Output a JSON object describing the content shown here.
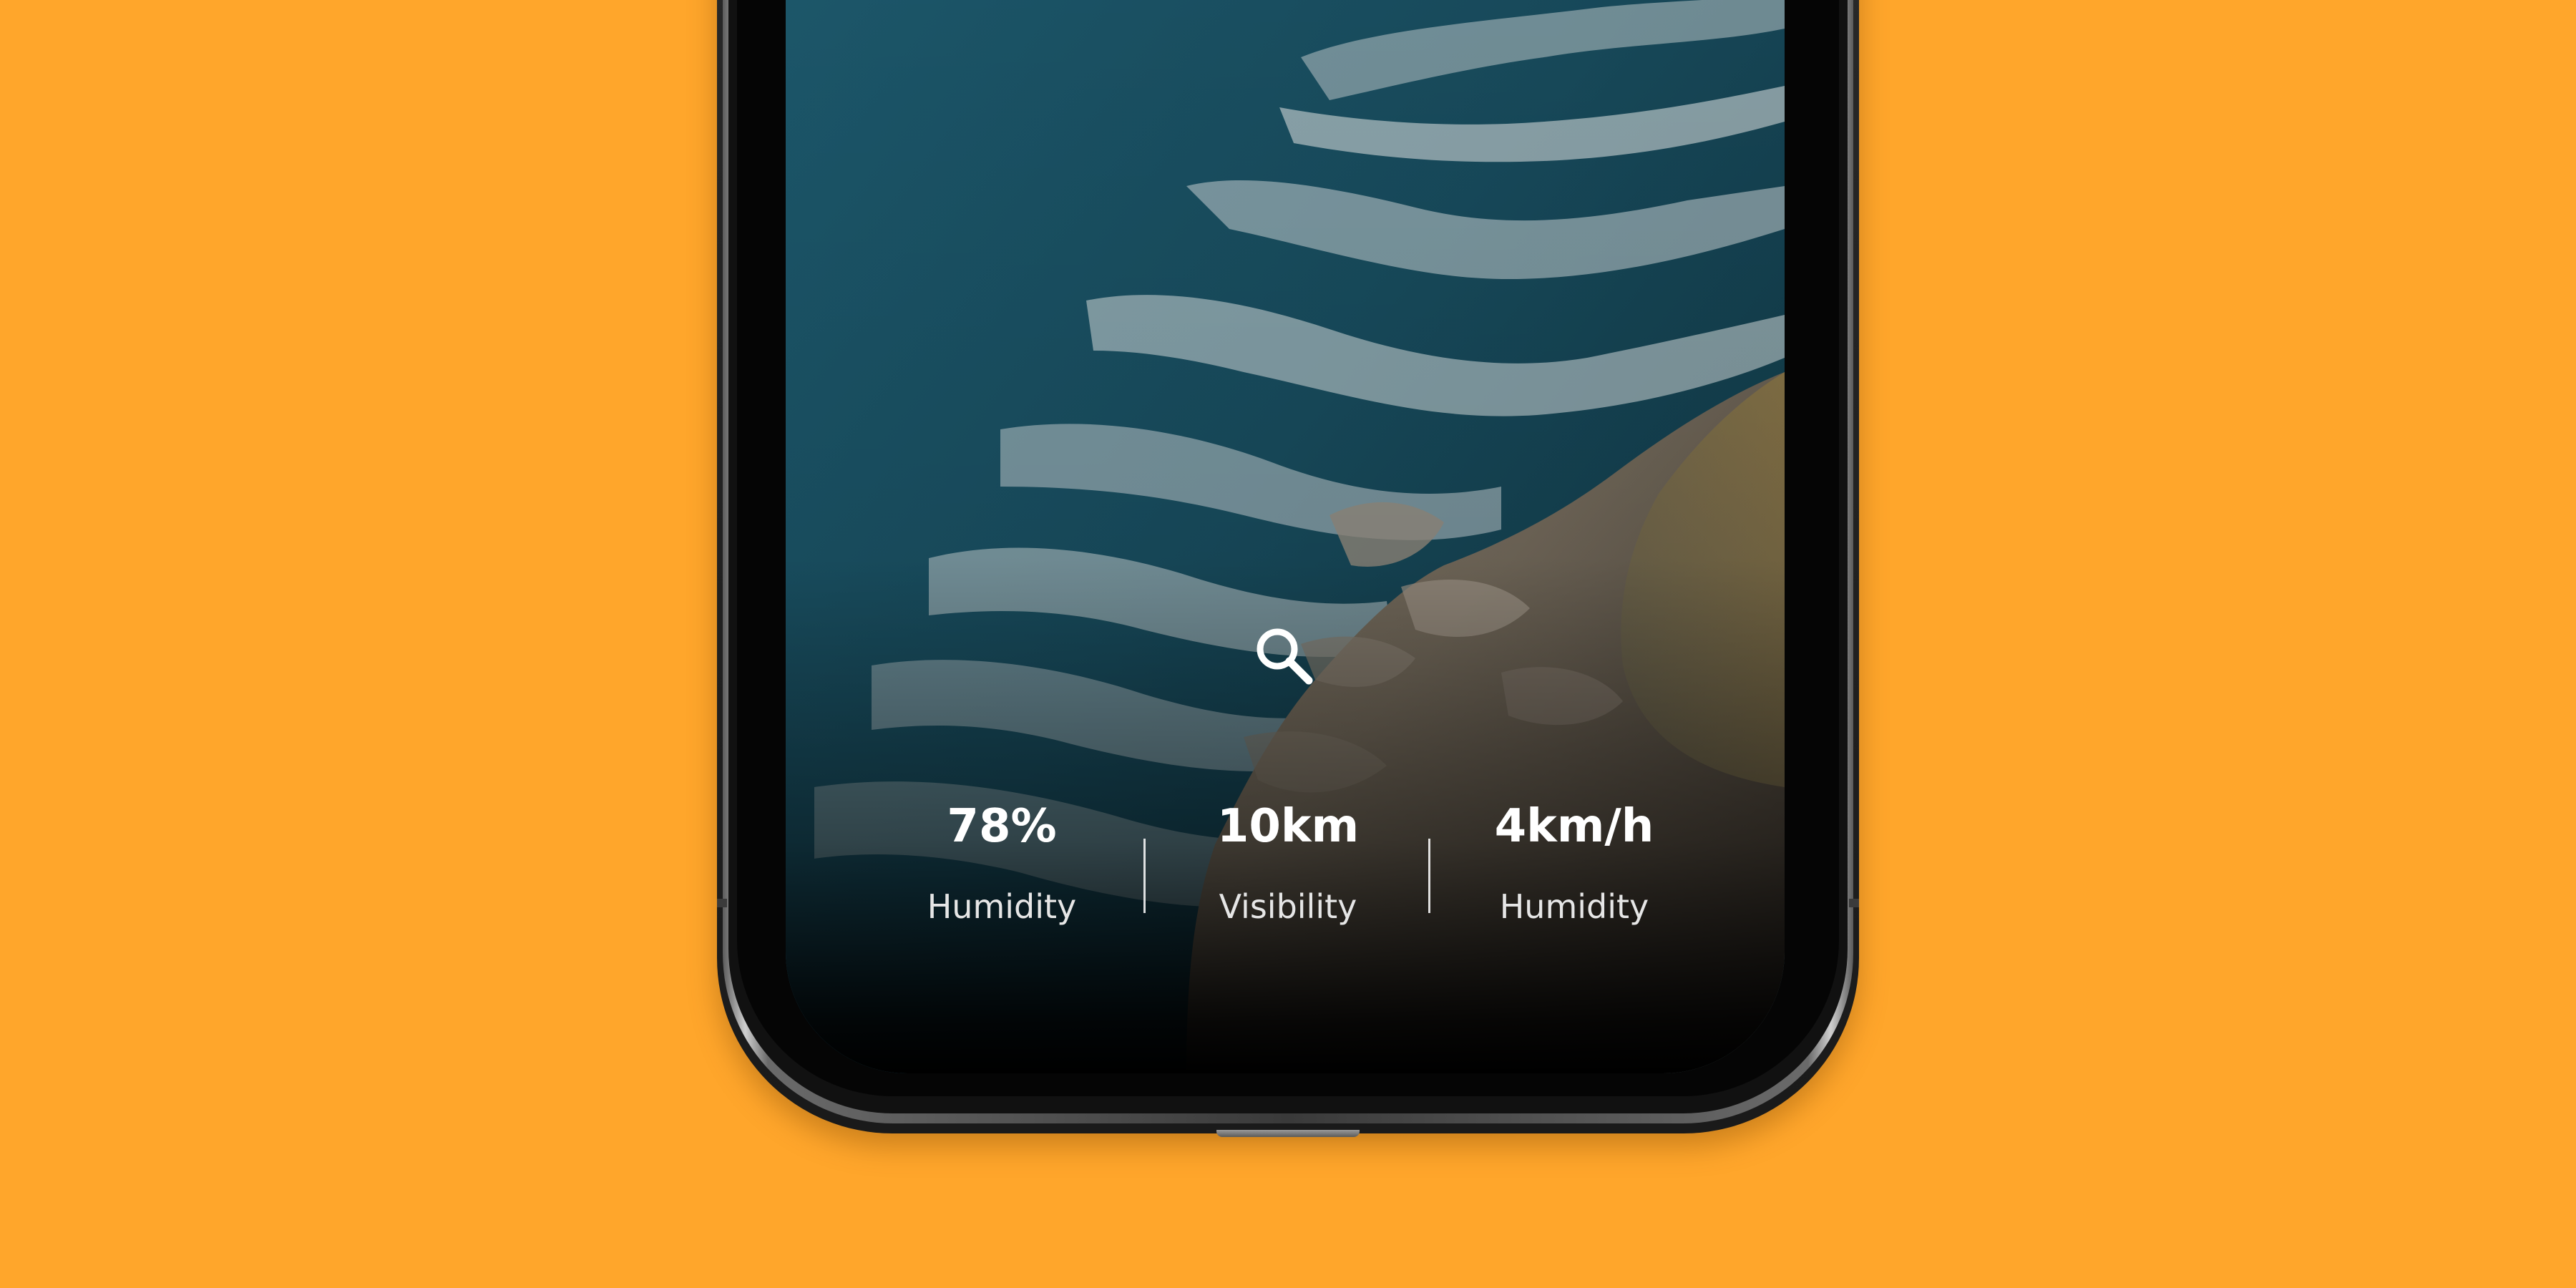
{
  "background_color": "#FFA62B",
  "search": {
    "icon": "search-icon"
  },
  "stats": [
    {
      "value": "78%",
      "label": "Humidity"
    },
    {
      "value": "10km",
      "label": "Visibility"
    },
    {
      "value": "4km/h",
      "label": "Humidity"
    }
  ]
}
